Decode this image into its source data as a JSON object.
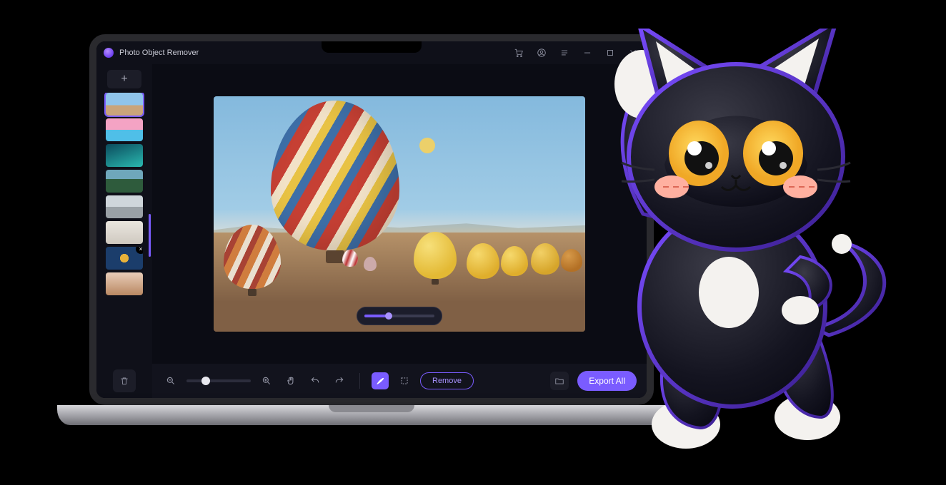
{
  "window": {
    "title": "Photo Object Remover",
    "controls": {
      "minimize": "−",
      "maximize": "□",
      "close": "×"
    },
    "headerIcons": {
      "cart": "cart-icon",
      "user": "user-icon",
      "menu": "menu-icon"
    }
  },
  "sidebar": {
    "addLabel": "+",
    "thumbnails": [
      {
        "id": 1,
        "selected": true,
        "subject": "hot-air-balloons"
      },
      {
        "id": 2,
        "selected": false,
        "subject": "pink-sky-beach"
      },
      {
        "id": 3,
        "selected": false,
        "subject": "teal-lagoon"
      },
      {
        "id": 4,
        "selected": false,
        "subject": "mountain-forest"
      },
      {
        "id": 5,
        "selected": false,
        "subject": "seascape"
      },
      {
        "id": 6,
        "selected": false,
        "subject": "desk-laptop"
      },
      {
        "id": 7,
        "selected": false,
        "subject": "food-flatlay",
        "removable": true
      },
      {
        "id": 8,
        "selected": false,
        "subject": "latte-pastry"
      }
    ],
    "trash": "trash-icon"
  },
  "canvas": {
    "subject": "Cappadocia hot-air balloons over arid valley at sunrise",
    "masked_object": "yellow balloon (brush selection)"
  },
  "brush": {
    "min": 0,
    "max": 100,
    "value": 35
  },
  "toolbar": {
    "zoom": {
      "min": 0,
      "max": 100,
      "value": 30
    },
    "tools": {
      "zoomOut": "zoom-out-icon",
      "zoomIn": "zoom-in-icon",
      "hand": "hand-icon",
      "undo": "undo-icon",
      "redo": "redo-icon",
      "brush": "brush-icon",
      "lasso": "rectangle-select-icon"
    },
    "removeLabel": "Remove",
    "folder": "folder-icon",
    "exportLabel": "Export All"
  },
  "colors": {
    "accent": "#7a5cff",
    "bg": "#0b0c14",
    "panel": "#12131d"
  },
  "mascot": {
    "name": "HitPaw cat mascot",
    "pose": "waving from behind laptop"
  }
}
